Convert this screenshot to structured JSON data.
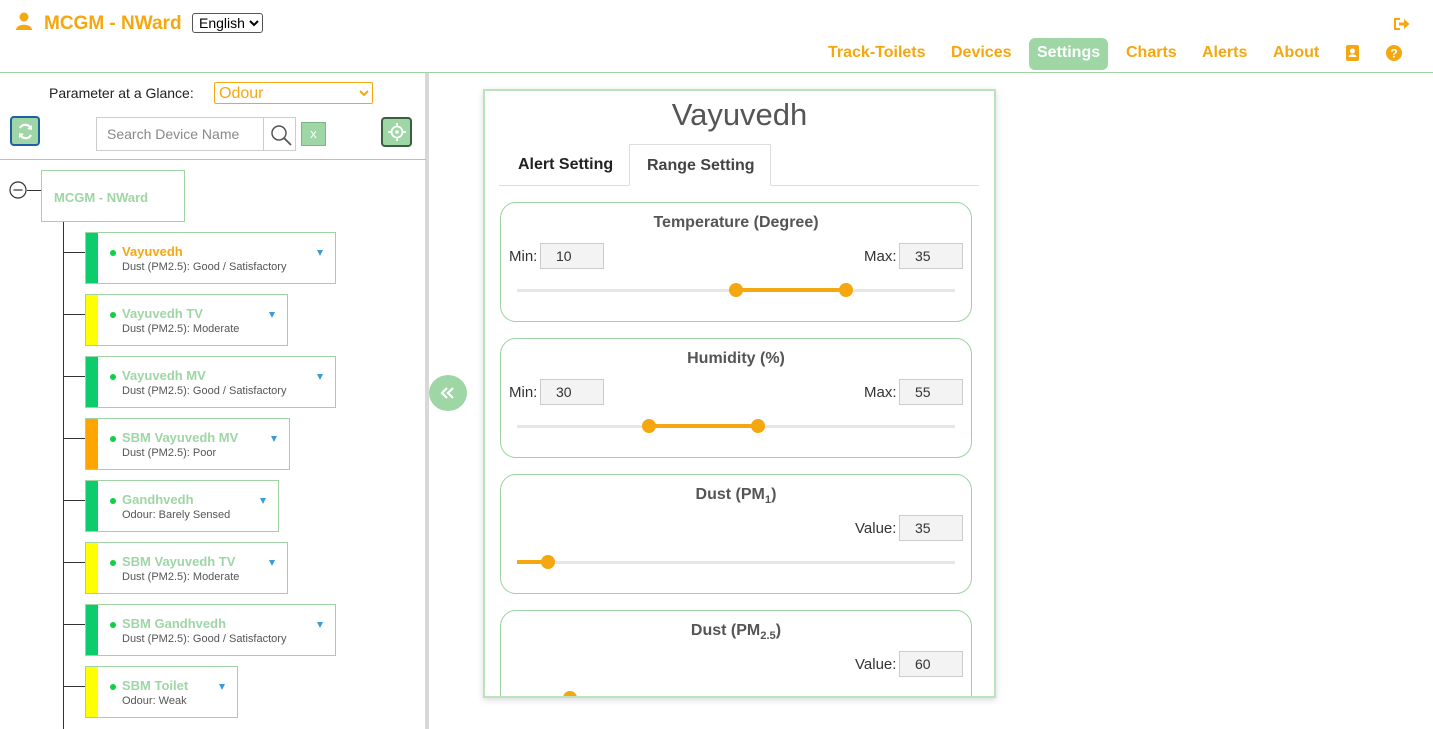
{
  "header": {
    "brand": "MCGM - NWard",
    "language": "English",
    "nav": [
      "Track-Toilets",
      "Devices",
      "Settings",
      "Charts",
      "Alerts",
      "About"
    ],
    "active_nav": "Settings",
    "icons": [
      "user-icon",
      "logout-icon",
      "contact-book-icon",
      "help-icon"
    ],
    "colors": {
      "accent": "#f5a70f",
      "active_bg": "#9ed6a5"
    }
  },
  "left": {
    "param_label": "Parameter at a Glance:",
    "param_value": "Odour",
    "search_placeholder": "Search Device Name",
    "clear_label": "x",
    "root": "MCGM - NWard",
    "devices": [
      {
        "name": "Vayuvedh",
        "status": "Dust (PM2.5): Good / Satisfactory",
        "color": "#0dcc6c",
        "selected": true
      },
      {
        "name": "Vayuvedh TV",
        "status": "Dust (PM2.5): Moderate",
        "color": "#ffff00"
      },
      {
        "name": "Vayuvedh MV",
        "status": "Dust (PM2.5): Good / Satisfactory",
        "color": "#0dcc6c"
      },
      {
        "name": "SBM Vayuvedh MV",
        "status": "Dust (PM2.5): Poor",
        "color": "#ffa500"
      },
      {
        "name": "Gandhvedh",
        "status": "Odour: Barely Sensed",
        "color": "#0dcc6c"
      },
      {
        "name": "SBM Vayuvedh TV",
        "status": "Dust (PM2.5): Moderate",
        "color": "#ffff00"
      },
      {
        "name": "SBM Gandhvedh",
        "status": "Dust (PM2.5): Good / Satisfactory",
        "color": "#0dcc6c"
      },
      {
        "name": "SBM Toilet",
        "status": "Odour: Weak",
        "color": "#ffff00"
      }
    ]
  },
  "card": {
    "title": "Vayuvedh",
    "tabs": [
      "Alert Setting",
      "Range Setting"
    ],
    "active_tab": "Range Setting",
    "min_label": "Min:",
    "max_label": "Max:",
    "value_label": "Value:",
    "params": [
      {
        "title": "Temperature (Degree)",
        "min": "10",
        "max": "35",
        "range_frac": [
          0.5,
          0.75
        ]
      },
      {
        "title": "Humidity (%)",
        "min": "30",
        "max": "55",
        "range_frac": [
          0.3,
          0.55
        ]
      },
      {
        "title_main": "Dust (PM",
        "title_sub": "1",
        "title_end": ")",
        "value": "35",
        "value_frac": 0.07
      },
      {
        "title_main": "Dust (PM",
        "title_sub": "2.5",
        "title_end": ")",
        "value": "60",
        "value_frac": 0.12
      }
    ]
  }
}
